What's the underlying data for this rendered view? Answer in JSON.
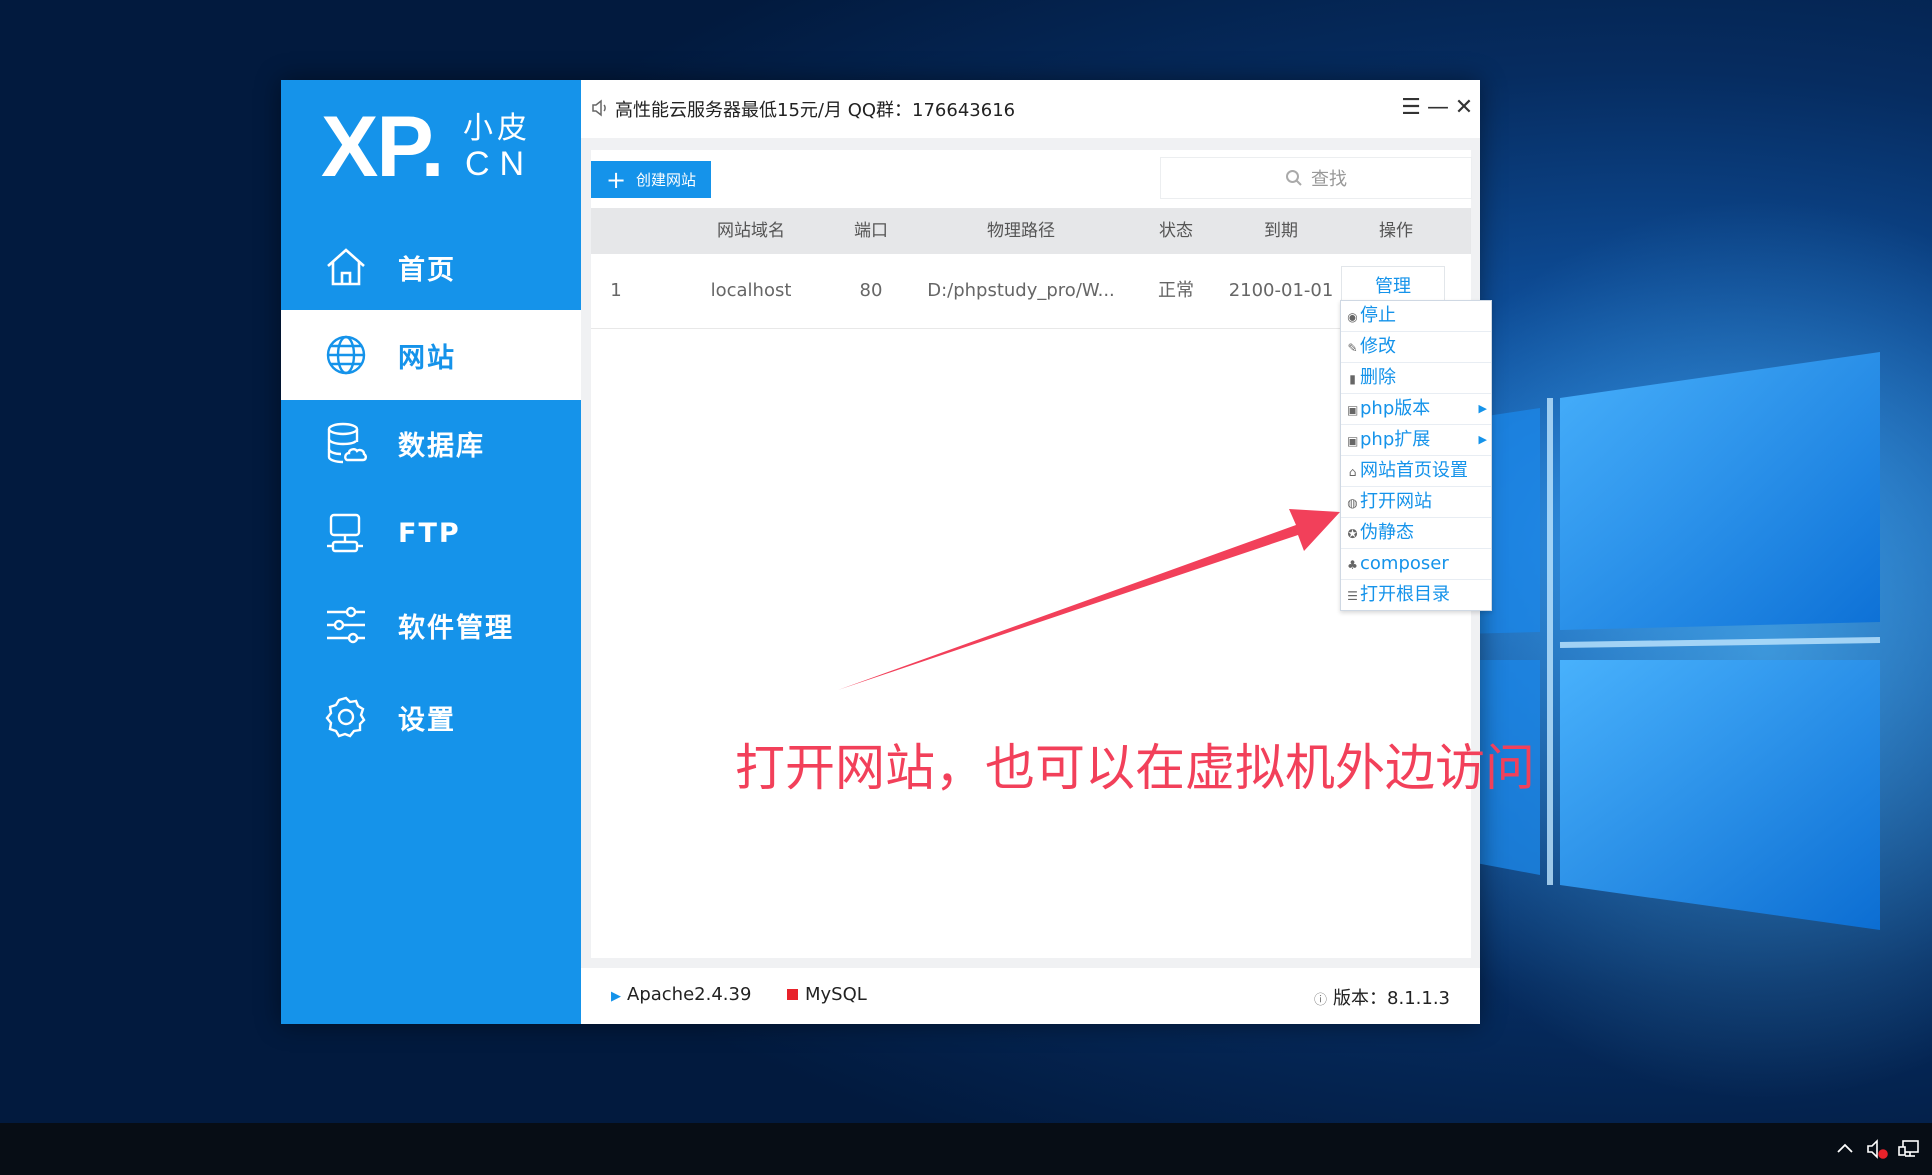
{
  "app": {
    "logo": {
      "main": "XP.",
      "sub_top": "小皮",
      "sub_bottom": "CN"
    },
    "notice": "高性能云服务器最低15元/月  QQ群：176643616",
    "window_controls": {
      "menu": "☰",
      "minimize": "—",
      "close": "✕"
    }
  },
  "sidebar": {
    "items": [
      {
        "label": "首页",
        "icon": "home-icon",
        "active": false
      },
      {
        "label": "网站",
        "icon": "globe-icon",
        "active": true
      },
      {
        "label": "数据库",
        "icon": "database-icon",
        "active": false
      },
      {
        "label": "FTP",
        "icon": "ftp-icon",
        "active": false
      },
      {
        "label": "软件管理",
        "icon": "sliders-icon",
        "active": false
      },
      {
        "label": "设置",
        "icon": "gear-icon",
        "active": false
      }
    ]
  },
  "toolbar": {
    "create_label": "创建网站",
    "search_placeholder": "查找"
  },
  "table": {
    "columns": [
      "网站域名",
      "端口",
      "物理路径",
      "状态",
      "到期",
      "操作"
    ],
    "rows": [
      {
        "index": "1",
        "domain": "localhost",
        "port": "80",
        "path": "D:/phpstudy_pro/W...",
        "status": "正常",
        "expiry": "2100-01-01",
        "action": "管理"
      }
    ]
  },
  "menu": {
    "items": [
      {
        "label": "停止",
        "icon": "stop-icon",
        "submenu": false
      },
      {
        "label": "修改",
        "icon": "edit-icon",
        "submenu": false
      },
      {
        "label": "删除",
        "icon": "trash-icon",
        "submenu": false
      },
      {
        "label": "php版本",
        "icon": "php-version-icon",
        "submenu": true
      },
      {
        "label": "php扩展",
        "icon": "php-extension-icon",
        "submenu": true
      },
      {
        "label": "网站首页设置",
        "icon": "home-page-icon",
        "submenu": false
      },
      {
        "label": "打开网站",
        "icon": "open-site-icon",
        "submenu": false
      },
      {
        "label": "伪静态",
        "icon": "rewrite-icon",
        "submenu": false
      },
      {
        "label": "composer",
        "icon": "composer-icon",
        "submenu": false
      },
      {
        "label": "打开根目录",
        "icon": "list-icon",
        "submenu": false
      }
    ]
  },
  "statusbar": {
    "apache": "Apache2.4.39",
    "mysql": "MySQL",
    "version": "版本：8.1.1.3"
  },
  "annotation": "打开网站，也可以在虚拟机外边访问",
  "colors": {
    "accent": "#1593ea",
    "annotation": "#f2405a",
    "mysql_status": "#e8222a",
    "taskbar": "#070d15"
  }
}
